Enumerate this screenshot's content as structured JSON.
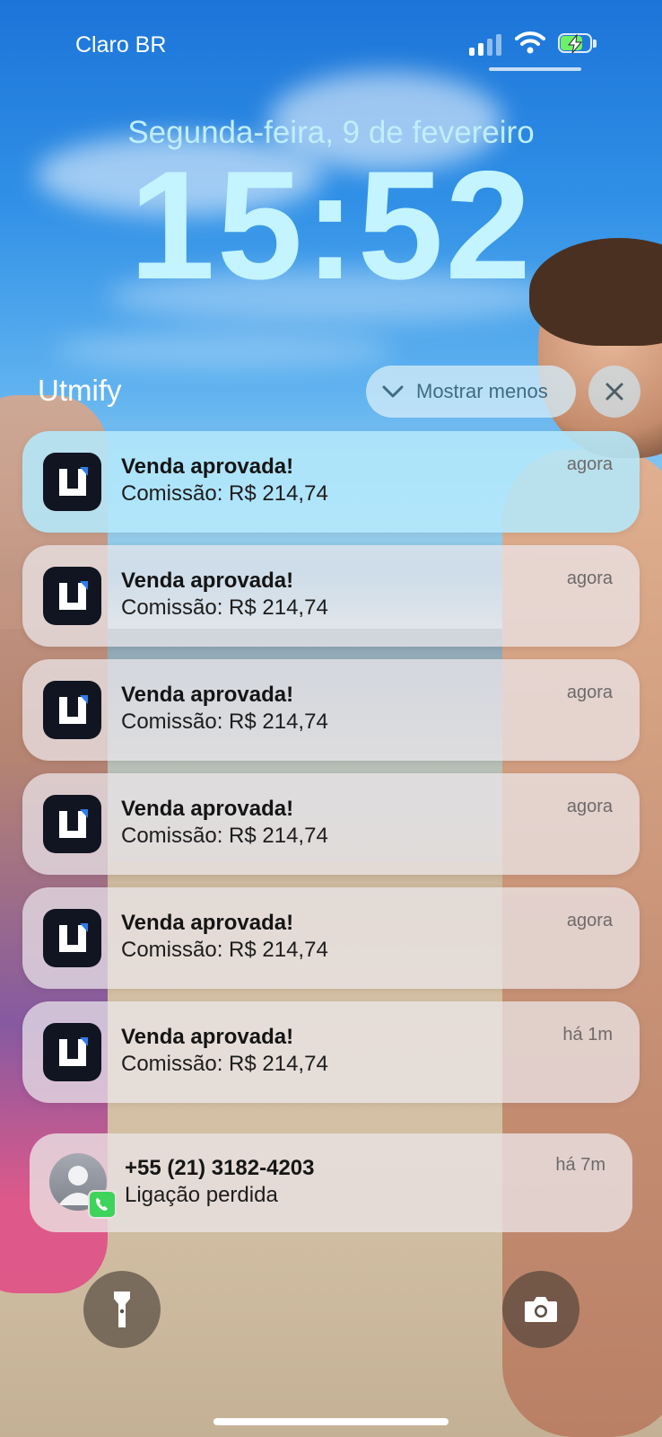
{
  "status_bar": {
    "carrier": "Claro BR",
    "signal_icon": "cellular-signal-icon",
    "wifi_icon": "wifi-icon",
    "battery_icon": "battery-charging-icon",
    "battery_color": "#6ef06a"
  },
  "lock_screen": {
    "date": "Segunda-feira, 9 de fevereiro",
    "time": "15:52"
  },
  "notification_group": {
    "app_name": "Utmify",
    "show_less_label": "Mostrar menos",
    "close_icon": "close-icon"
  },
  "notifications": [
    {
      "title": "Venda aprovada!",
      "body": "Comissão: R$ 214,74",
      "when": "agora"
    },
    {
      "title": "Venda aprovada!",
      "body": "Comissão: R$ 214,74",
      "when": "agora"
    },
    {
      "title": "Venda aprovada!",
      "body": "Comissão: R$ 214,74",
      "when": "agora"
    },
    {
      "title": "Venda aprovada!",
      "body": "Comissão: R$ 214,74",
      "when": "agora"
    },
    {
      "title": "Venda aprovada!",
      "body": "Comissão: R$ 214,74",
      "when": "agora"
    },
    {
      "title": "Venda aprovada!",
      "body": "Comissão: R$ 214,74",
      "when": "há 1m"
    }
  ],
  "missed_call": {
    "title": "+55 (21) 3182-4203",
    "body": "Ligação perdida",
    "when": "há 7m"
  },
  "quick_actions": {
    "left_icon": "flashlight-icon",
    "right_icon": "camera-icon"
  }
}
